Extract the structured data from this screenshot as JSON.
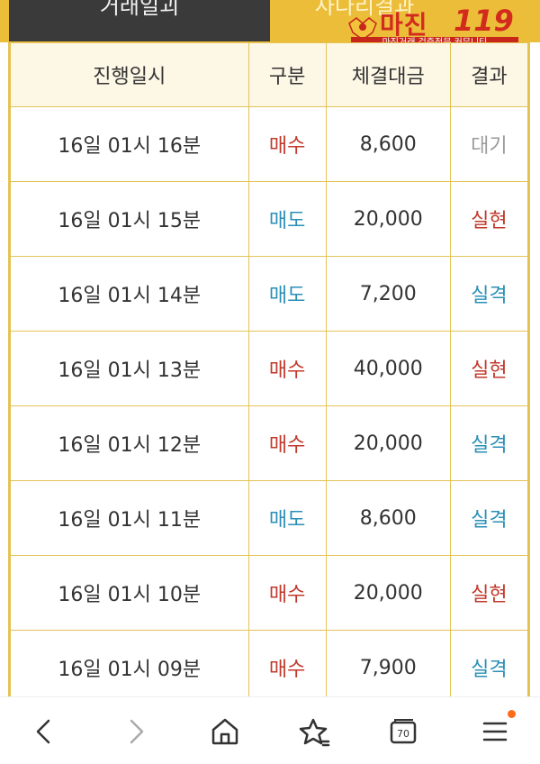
{
  "header": {
    "tab_left": "거래일괴",
    "tab_right": "사다리결과"
  },
  "logo": {
    "name": "마진",
    "number": "119",
    "tagline": "마진거래 검증전문 커뮤니티"
  },
  "table": {
    "columns": [
      "진행일시",
      "구분",
      "체결대금",
      "결과"
    ],
    "rows": [
      {
        "time": "16일 01시 16분",
        "side": "매수",
        "amount": "8,600",
        "result": "대기"
      },
      {
        "time": "16일 01시 15분",
        "side": "매도",
        "amount": "20,000",
        "result": "실현"
      },
      {
        "time": "16일 01시 14분",
        "side": "매도",
        "amount": "7,200",
        "result": "실격"
      },
      {
        "time": "16일 01시 13분",
        "side": "매수",
        "amount": "40,000",
        "result": "실현"
      },
      {
        "time": "16일 01시 12분",
        "side": "매수",
        "amount": "20,000",
        "result": "실격"
      },
      {
        "time": "16일 01시 11분",
        "side": "매도",
        "amount": "8,600",
        "result": "실격"
      },
      {
        "time": "16일 01시 10분",
        "side": "매수",
        "amount": "20,000",
        "result": "실현"
      },
      {
        "time": "16일 01시 09분",
        "side": "매수",
        "amount": "7,900",
        "result": "실격"
      }
    ]
  },
  "nav": {
    "tabs_count": "70",
    "icons": [
      "back-icon",
      "forward-icon",
      "home-icon",
      "bookmark-star-icon",
      "tabs-icon",
      "menu-icon"
    ]
  },
  "colors": {
    "gold": "#ebbd38",
    "buy": "#c0392b",
    "sell": "#2a8fb6",
    "wait": "#9a9a9a",
    "notification": "#ff6a1a"
  }
}
